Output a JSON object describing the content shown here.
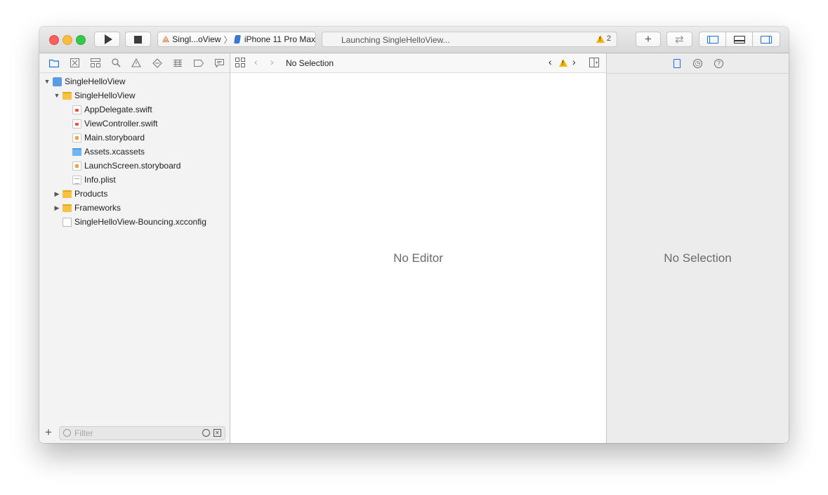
{
  "toolbar": {
    "scheme_target": "Singl...oView",
    "device": "iPhone 11 Pro Max",
    "activity_status": "Launching SingleHelloView...",
    "warning_count": "2",
    "add_label": "+",
    "swap_label": "⇄"
  },
  "navigator": {
    "tabs": [
      "folder-icon",
      "source-control-icon",
      "symbol-icon",
      "find-icon",
      "issue-icon",
      "test-icon",
      "debug-icon",
      "breakpoint-icon",
      "report-icon"
    ],
    "tree": [
      {
        "label": "SingleHelloView",
        "icon": "project-icon",
        "indent": 0,
        "disclosure": "▼"
      },
      {
        "label": "SingleHelloView",
        "icon": "folder-icon",
        "indent": 1,
        "disclosure": "▼"
      },
      {
        "label": "AppDelegate.swift",
        "icon": "swift-file-icon",
        "indent": 2,
        "disclosure": ""
      },
      {
        "label": "ViewController.swift",
        "icon": "swift-file-icon",
        "indent": 2,
        "disclosure": ""
      },
      {
        "label": "Main.storyboard",
        "icon": "storyboard-icon",
        "indent": 2,
        "disclosure": ""
      },
      {
        "label": "Assets.xcassets",
        "icon": "assets-folder-icon",
        "indent": 2,
        "disclosure": ""
      },
      {
        "label": "LaunchScreen.storyboard",
        "icon": "storyboard-icon",
        "indent": 2,
        "disclosure": ""
      },
      {
        "label": "Info.plist",
        "icon": "plist-icon",
        "indent": 2,
        "disclosure": ""
      },
      {
        "label": "Products",
        "icon": "folder-icon",
        "indent": 1,
        "disclosure": "▶"
      },
      {
        "label": "Frameworks",
        "icon": "folder-icon",
        "indent": 1,
        "disclosure": "▶"
      },
      {
        "label": "SingleHelloView-Bouncing.xcconfig",
        "icon": "config-file-icon",
        "indent": 1,
        "disclosure": ""
      }
    ],
    "filter_placeholder": "Filter"
  },
  "editor": {
    "jump_bar_title": "No Selection",
    "empty_text": "No Editor"
  },
  "inspector": {
    "empty_text": "No Selection"
  },
  "colors": {
    "accent": "#1a6ee6",
    "warning": "#f5b400"
  }
}
